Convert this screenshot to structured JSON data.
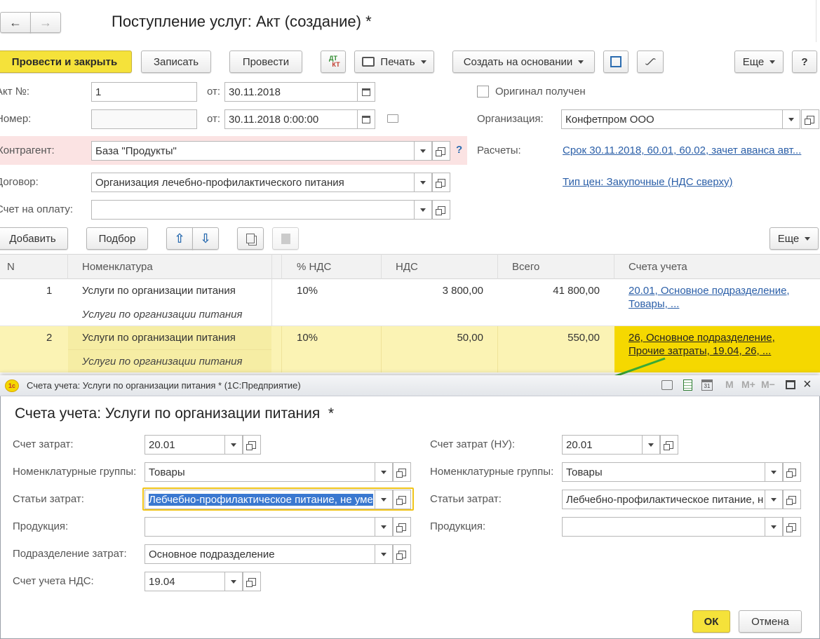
{
  "window": {
    "title": "Поступление услуг: Акт (создание) *"
  },
  "toolbar": {
    "post_close": "Провести и закрыть",
    "save": "Записать",
    "post": "Провести",
    "dtkt_top": "ДТ",
    "dtkt_bottom": "КТ",
    "print": "Печать",
    "create_based": "Создать на основании",
    "more": "Еще",
    "help": "?"
  },
  "header": {
    "act_no_label": "Акт №:",
    "act_no_value": "1",
    "from_label": "от:",
    "act_date": "30.11.2018",
    "number_label": "Номер:",
    "number_value": "",
    "from_label2": "от:",
    "number_date": "30.11.2018  0:00:00",
    "original_label": "Оригинал получен",
    "org_label": "Организация:",
    "org_value": "Конфетпром ООО",
    "contractor_label": "Контрагент:",
    "contractor_value": "База \"Продукты\"",
    "contractor_help": "?",
    "settlements_label": "Расчеты:",
    "settlements_link": "Срок 30.11.2018, 60.01, 60.02, зачет аванса авт...",
    "contract_label": "Договор:",
    "contract_value": "Организация лечебно-профилактического питания",
    "price_type_link": "Тип цен: Закупочные (НДС сверху)",
    "invoice_label": "Счет на оплату:",
    "invoice_value": ""
  },
  "table_toolbar": {
    "add": "Добавить",
    "select": "Подбор",
    "more": "Еще"
  },
  "table": {
    "columns": [
      "N",
      "Номенклатура",
      "% НДС",
      "НДС",
      "Всего",
      "Счета учета"
    ],
    "rows": [
      {
        "n": "1",
        "item": "Услуги по организации питания",
        "item2": "Услуги по организации питания",
        "vat_rate": "10%",
        "vat": "3 800,00",
        "total": "41 800,00",
        "accounts1": "20.01, Основное подразделение,",
        "accounts2": "Товары, ..."
      },
      {
        "n": "2",
        "item": "Услуги по организации питания",
        "item2": "Услуги по организации питания",
        "vat_rate": "10%",
        "vat": "50,00",
        "total": "550,00",
        "accounts1": "26, Основное подразделение,",
        "accounts2": "Прочие затраты, 19.04, 26, ..."
      }
    ]
  },
  "dialog": {
    "titlebar": "Счета учета: Услуги по организации питания * (1С:Предприятие)",
    "titlebar_icons": [
      "M",
      "M+",
      "M−"
    ],
    "heading": "Счета учета: Услуги по организации питания  *",
    "left": {
      "cost_account_label": "Счет затрат:",
      "cost_account_value": "20.01",
      "nom_groups_label": "Номенклатурные группы:",
      "nom_groups_value": "Товары",
      "cost_items_label": "Статьи затрат:",
      "cost_items_value": "Лебчебно-профилактическое питание, не уме",
      "production_label": "Продукция:",
      "production_value": "",
      "division_label": "Подразделение затрат:",
      "division_value": "Основное подразделение",
      "vat_account_label": "Счет учета НДС:",
      "vat_account_value": "19.04"
    },
    "right": {
      "cost_account_label": "Счет затрат (НУ):",
      "cost_account_value": "20.01",
      "nom_groups_label": "Номенклатурные группы:",
      "nom_groups_value": "Товары",
      "cost_items_label": "Статьи затрат:",
      "cost_items_value": "Лебчебно-профилактическое питание, н",
      "production_label": "Продукция:",
      "production_value": ""
    },
    "ok": "ОК",
    "cancel": "Отмена"
  },
  "colors": {
    "accent_yellow": "#f5e23a",
    "selected_row": "#fbf3b4",
    "selected_cell": "#f5d800",
    "invalid_field": "#fbe3e3",
    "link": "#2b5fa8",
    "arrow": "#3aaa35"
  }
}
